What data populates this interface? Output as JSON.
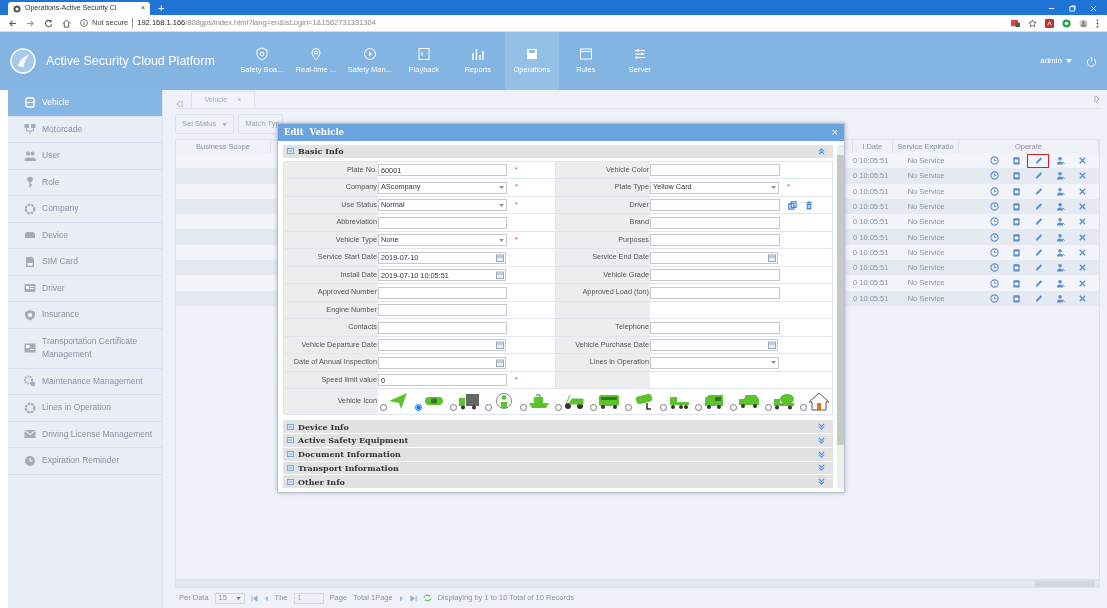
{
  "browser": {
    "tab_title": "Operations-Active Security Cl",
    "tab_close": "×",
    "new_tab": "+",
    "security": "Not secure",
    "url_host": "192.168.1.166",
    "url_path": "/808gps/index.html?lang=en&isLogin=1&1562731331304"
  },
  "header": {
    "title": "Active Security Cloud Platform",
    "user": "admin",
    "nav": [
      {
        "label": "Safety Boa...",
        "selected": false
      },
      {
        "label": "Real-time ...",
        "selected": false
      },
      {
        "label": "Safety Man...",
        "selected": false
      },
      {
        "label": "Playback",
        "selected": false
      },
      {
        "label": "Reports",
        "selected": false
      },
      {
        "label": "Operations",
        "selected": true
      },
      {
        "label": "Rules",
        "selected": false
      },
      {
        "label": "Server",
        "selected": false
      }
    ]
  },
  "sidebar": {
    "items": [
      {
        "label": "Vehicle",
        "selected": true
      },
      {
        "label": "Motorcade",
        "selected": false
      },
      {
        "label": "User",
        "selected": false
      },
      {
        "label": "Role",
        "selected": false
      },
      {
        "label": "Company",
        "selected": false
      },
      {
        "label": "Device",
        "selected": false
      },
      {
        "label": "SIM Card",
        "selected": false
      },
      {
        "label": "Driver",
        "selected": false
      },
      {
        "label": "Insurance",
        "selected": false
      },
      {
        "label": "Transportation Certificate Management",
        "selected": false
      },
      {
        "label": "Maintenance Management",
        "selected": false
      },
      {
        "label": "Lines in Operation",
        "selected": false
      },
      {
        "label": "Driving License Management",
        "selected": false
      },
      {
        "label": "Expiration Reminder",
        "selected": false
      }
    ]
  },
  "tabs": [
    {
      "label": "Vehicle",
      "close": "×",
      "selected": true
    }
  ],
  "toolbar": {
    "filters": [
      "Sel Status",
      "Match Typ"
    ]
  },
  "table": {
    "columns": [
      "Business Scope",
      "l Date",
      "Service Expiratio",
      "Operate"
    ],
    "rows": [
      {
        "date": "0 10:05:51",
        "service": "No Service",
        "edit_highlighted": true
      },
      {
        "date": "0 10:05:51",
        "service": "No Service",
        "edit_highlighted": false
      },
      {
        "date": "0 10:05:51",
        "service": "No Service",
        "edit_highlighted": false
      },
      {
        "date": "0 10:05:51",
        "service": "No Service",
        "edit_highlighted": false
      },
      {
        "date": "0 10:05:51",
        "service": "No Service",
        "edit_highlighted": false
      },
      {
        "date": "0 10:05:51",
        "service": "No Service",
        "edit_highlighted": false
      },
      {
        "date": "0 10:05:51",
        "service": "No Service",
        "edit_highlighted": false
      },
      {
        "date": "0 10:05:51",
        "service": "No Service",
        "edit_highlighted": false
      },
      {
        "date": "0 10:05:51",
        "service": "No Service",
        "edit_highlighted": false
      },
      {
        "date": "0 10:05:51",
        "service": "No Service",
        "edit_highlighted": false
      }
    ]
  },
  "pager": {
    "per_data_label": "Per Data",
    "per_data": "15",
    "the": "The",
    "page": "1",
    "page_label": "Page",
    "total": "Total 1Page",
    "summary": "Displaying by 1 to 10 Total of 10 Records"
  },
  "dialog": {
    "title_action": "Edit",
    "title_object": "Vehicle",
    "close": "×",
    "sections": [
      {
        "title": "Basic Info",
        "expanded": true,
        "rows": [
          {
            "left": {
              "label": "Plate No.",
              "kind": "text",
              "value": "60001",
              "required_mark": "*"
            },
            "right": {
              "label": "Vehicle Color",
              "kind": "text"
            }
          },
          {
            "left": {
              "label": "Company",
              "kind": "select",
              "value": "AScompany",
              "required_mark": "*"
            },
            "right": {
              "label": "Plate Type",
              "kind": "select",
              "value": "Yellow Card",
              "required_mark": "*"
            }
          },
          {
            "left": {
              "label": "Use Status",
              "kind": "select",
              "value": "Normal",
              "required_mark": "*"
            },
            "right": {
              "label": "Driver",
              "kind": "picker"
            }
          },
          {
            "left": {
              "label": "Abbreviation",
              "kind": "text"
            },
            "right": {
              "label": "Brand",
              "kind": "text"
            }
          },
          {
            "left": {
              "label": "Vehicle Type",
              "kind": "select",
              "value": "None",
              "required_mark": "*"
            },
            "right": {
              "label": "Purposes",
              "kind": "text"
            }
          },
          {
            "left": {
              "label": "Service Start Date",
              "kind": "date",
              "value": "2019-07-10"
            },
            "right": {
              "label": "Service End Date",
              "kind": "date"
            }
          },
          {
            "left": {
              "label": "Install Date",
              "kind": "date",
              "value": "2019-07-10 10:05:51"
            },
            "right": {
              "label": "Vehicle Grade",
              "kind": "text"
            }
          },
          {
            "left": {
              "label": "Approved Number",
              "kind": "text"
            },
            "right": {
              "label": "Approved Load (ton)",
              "kind": "text"
            }
          },
          {
            "left": {
              "label": "Engine Number",
              "kind": "text"
            },
            "right": null
          },
          {
            "left": {
              "label": "Contacts",
              "kind": "text"
            },
            "right": {
              "label": "Telephone",
              "kind": "text"
            }
          },
          {
            "left": {
              "label": "Vehicle Departure Date",
              "kind": "date"
            },
            "right": {
              "label": "Vehicle Purchase Date",
              "kind": "date"
            }
          },
          {
            "left": {
              "label": "Date of Annual Inspection",
              "kind": "date"
            },
            "right": {
              "label": "Lines in Operation",
              "kind": "select"
            }
          },
          {
            "left": {
              "label": "Speed limit value",
              "kind": "text",
              "value": "0",
              "required_mark": "*"
            },
            "right": null
          }
        ],
        "icon_label": "Vehicle Icon",
        "vehicle_icons": [
          {
            "kind": "arrow",
            "selected": false
          },
          {
            "kind": "car",
            "selected": true
          },
          {
            "kind": "truck",
            "selected": false
          },
          {
            "kind": "person",
            "selected": false
          },
          {
            "kind": "boat",
            "selected": false
          },
          {
            "kind": "scooter",
            "selected": false
          },
          {
            "kind": "bus",
            "selected": false
          },
          {
            "kind": "crane",
            "selected": false
          },
          {
            "kind": "tractor",
            "selected": false
          },
          {
            "kind": "van",
            "selected": false
          },
          {
            "kind": "jeep",
            "selected": false
          },
          {
            "kind": "mixer",
            "selected": false
          },
          {
            "kind": "house",
            "selected": false
          }
        ]
      },
      {
        "title": "Device Info",
        "expanded": false
      },
      {
        "title": "Active Safety Equipment",
        "expanded": false
      },
      {
        "title": "Document Information",
        "expanded": false
      },
      {
        "title": "Transport Information",
        "expanded": false
      },
      {
        "title": "Other Info",
        "expanded": false
      }
    ]
  }
}
